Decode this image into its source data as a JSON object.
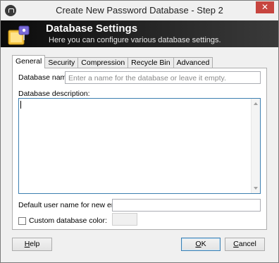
{
  "window": {
    "title": "Create New Password Database - Step 2",
    "close_glyph": "✕"
  },
  "banner": {
    "title": "Database Settings",
    "subtitle": "Here you can configure various database settings.",
    "icon": "keepass-database-icon"
  },
  "tabs": [
    {
      "label": "General",
      "active": true
    },
    {
      "label": "Security",
      "active": false
    },
    {
      "label": "Compression",
      "active": false
    },
    {
      "label": "Recycle Bin",
      "active": false
    },
    {
      "label": "Advanced",
      "active": false
    }
  ],
  "general": {
    "db_name_label": "Database name:",
    "db_name_placeholder": "Enter a name for the database or leave it empty.",
    "db_name_value": "",
    "db_desc_label": "Database description:",
    "db_desc_value": "",
    "default_user_label": "Default user name for new entries:",
    "default_user_value": "",
    "custom_color_label": "Custom database color:",
    "custom_color_checked": false
  },
  "buttons": {
    "help": {
      "accel": "H",
      "rest": "elp"
    },
    "ok": {
      "accel": "O",
      "rest": "K"
    },
    "cancel": {
      "accel": "C",
      "rest": "ancel"
    }
  },
  "colors": {
    "banner_bg": "#1a1a1a",
    "close_button": "#c7453f",
    "focus_border": "#3c7fb1"
  }
}
